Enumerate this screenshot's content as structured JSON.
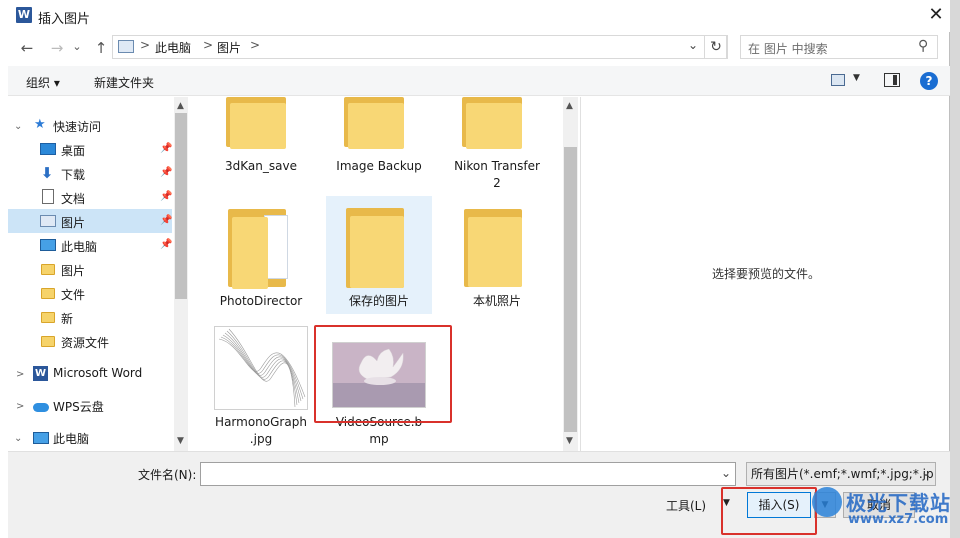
{
  "titlebar": {
    "title": "插入图片",
    "app_icon": "W",
    "close_glyph": "✕"
  },
  "address": {
    "back_glyph": "←",
    "forward_glyph": "→",
    "history_glyph": "⌄",
    "up_glyph": "↑",
    "crumbs": [
      "此电脑",
      "图片"
    ],
    "separator": ">",
    "dropdown_glyph": "⌄",
    "refresh_glyph": "↻"
  },
  "search": {
    "placeholder": "在 图片 中搜索",
    "icon_glyph": "⚲"
  },
  "toolbar": {
    "organize_label": "组织 ▾",
    "new_folder_label": "新建文件夹",
    "help_glyph": "?",
    "view_dd_glyph": "▼"
  },
  "nav": {
    "quick_access": "快速访问",
    "items": [
      {
        "label": "桌面",
        "pinned": true
      },
      {
        "label": "下载",
        "pinned": true
      },
      {
        "label": "文档",
        "pinned": true
      },
      {
        "label": "图片",
        "pinned": true
      },
      {
        "label": "此电脑",
        "pinned": true
      },
      {
        "label": "图片",
        "pinned": false
      },
      {
        "label": "文件",
        "pinned": false
      },
      {
        "label": "新",
        "pinned": false
      },
      {
        "label": "资源文件",
        "pinned": false
      }
    ],
    "word": "Microsoft Word",
    "wps": "WPS云盘",
    "this_pc": "此电脑",
    "expand_glyph": ">",
    "collapse_glyph": "⌄",
    "pin_glyph": "📌",
    "scroll_up": "▲",
    "scroll_down": "▼"
  },
  "files": [
    {
      "name": "3dKan_save",
      "kind": "folder"
    },
    {
      "name": "Image Backup",
      "kind": "folder"
    },
    {
      "name": "Nikon Transfer",
      "name2": "2",
      "kind": "folder"
    },
    {
      "name": "PhotoDirector",
      "kind": "folder-docs"
    },
    {
      "name": "保存的图片",
      "kind": "folder",
      "selected": true
    },
    {
      "name": "本机照片",
      "kind": "folder"
    },
    {
      "name": "HarmonoGraph",
      "name2": ".jpg",
      "kind": "image-graph"
    },
    {
      "name": "VideoSource.b",
      "name2": "mp",
      "kind": "image-swan"
    }
  ],
  "preview": {
    "message": "选择要预览的文件。"
  },
  "bottom": {
    "filename_label": "文件名(N):",
    "filename_value": "",
    "filename_dd": "⌄",
    "filetype_value": "所有图片(*.emf;*.wmf;*.jpg;*.jp",
    "filetype_dd": "⌄",
    "tools_label": "工具(L)",
    "tools_dd": "▼",
    "insert_label": "插入(S)",
    "insert_dd": "▼",
    "cancel_label": "取消"
  },
  "watermark": {
    "text": "极光下载站",
    "url": "www.xz7.com"
  },
  "colors": {
    "accent": "#0078d7",
    "highlight_red": "#d9312b",
    "selection": "#cce4f7"
  }
}
